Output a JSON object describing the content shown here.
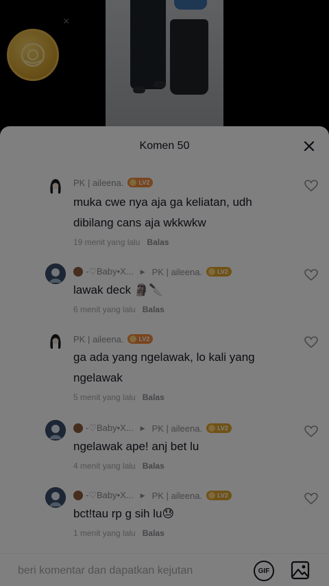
{
  "sheet": {
    "title": "Komen 50"
  },
  "comments": [
    {
      "username": "PK | aileena.",
      "badge": "LV2",
      "text": "muka cwe nya aja ga keliatan, udh dibilang cans aja wkkwkw",
      "time": "19 menit yang lalu",
      "reply_label": "Balas"
    },
    {
      "username": "-♡Baby•X...",
      "reply_to": "PK | aileena.",
      "badge": "LV2",
      "text": "lawak deck 🗿🔪",
      "time": "6 menit yang lalu",
      "reply_label": "Balas"
    },
    {
      "username": "PK | aileena.",
      "badge": "LV2",
      "text": "ga ada yang ngelawak, lo kali yang ngelawak",
      "time": "5 menit yang lalu",
      "reply_label": "Balas"
    },
    {
      "username": "-♡Baby•X...",
      "reply_to": "PK | aileena.",
      "badge": "LV2",
      "text": "ngelawak ape! anj bet lu",
      "time": "4 menit yang lalu",
      "reply_label": "Balas"
    },
    {
      "username": "-♡Baby•X...",
      "reply_to": "PK | aileena.",
      "badge": "LV2",
      "text": "bct!tau rp g sih lu😓",
      "time": "1 menit yang lalu",
      "reply_label": "Balas"
    }
  ],
  "footer": {
    "placeholder": "beri komentar dan dapatkan kejutan",
    "gif_label": "GIF"
  },
  "icons": {
    "close": "close-icon",
    "heart": "heart-icon",
    "gif": "gif-icon",
    "image": "image-icon",
    "coin": "coin-icon"
  },
  "colors": {
    "badge_orange": "#f08a3c",
    "badge_gold": "#e0a52b",
    "text_primary": "#161823",
    "text_secondary": "#8a8b91"
  }
}
